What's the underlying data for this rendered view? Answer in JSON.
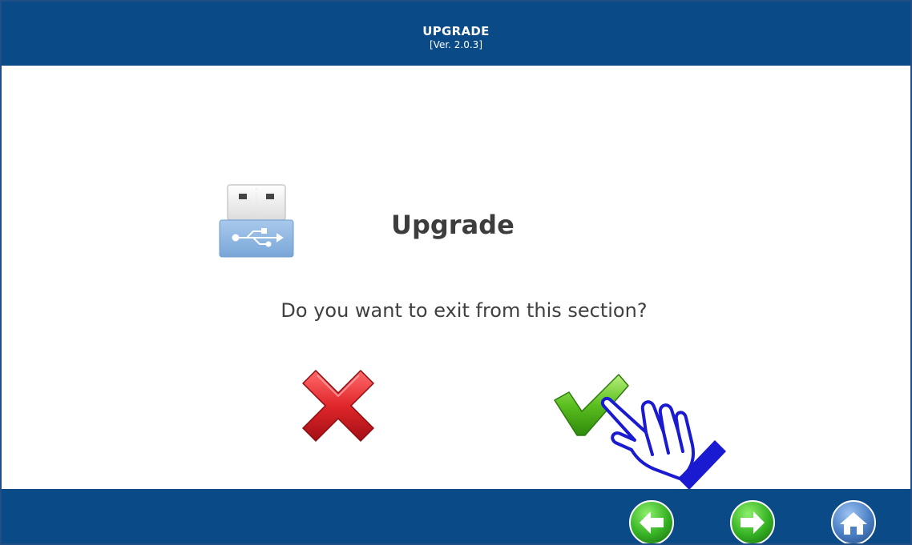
{
  "header": {
    "title": "UPGRADE",
    "version": "[Ver. 2.0.3]"
  },
  "dialog": {
    "title": "Upgrade",
    "question": "Do you want to exit from this section?",
    "icon": "usb-drive-icon",
    "cancel_icon": "red-x-icon",
    "confirm_icon": "green-check-icon",
    "cursor_icon": "pointing-hand-icon"
  },
  "footer": {
    "back_icon": "arrow-left-icon",
    "forward_icon": "arrow-right-icon",
    "home_icon": "home-icon"
  },
  "colors": {
    "header_bg": "#0a4a86",
    "footer_bg": "#0a4a86",
    "nav_button": "#36b324",
    "home_button": "#4b7fc6",
    "cancel": "#e0262b",
    "confirm": "#5bbf1f"
  }
}
